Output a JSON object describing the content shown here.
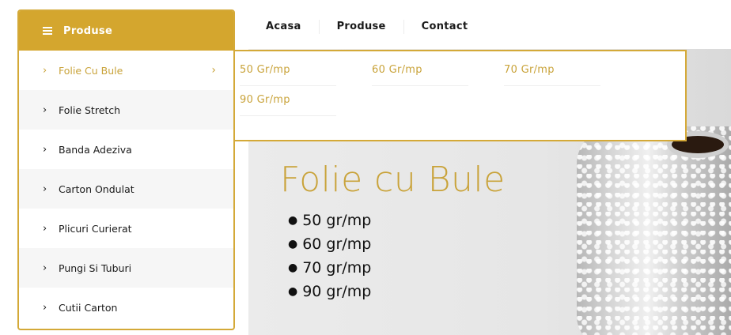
{
  "nav": {
    "items": [
      {
        "label": "Acasa"
      },
      {
        "label": "Produse"
      },
      {
        "label": "Contact"
      }
    ]
  },
  "categories": {
    "header": "Produse",
    "items": [
      {
        "label": "Folie Cu Bule",
        "active": true
      },
      {
        "label": "Folie Stretch"
      },
      {
        "label": "Banda Adeziva"
      },
      {
        "label": "Carton Ondulat"
      },
      {
        "label": "Plicuri Curierat"
      },
      {
        "label": "Pungi Si Tuburi"
      },
      {
        "label": "Cutii Carton"
      }
    ]
  },
  "submenu": {
    "items": [
      {
        "label": "50 Gr/mp"
      },
      {
        "label": "60 Gr/mp"
      },
      {
        "label": "70 Gr/mp"
      },
      {
        "label": "90 Gr/mp"
      }
    ]
  },
  "hero": {
    "title": "Folie cu Bule",
    "bullets": [
      "50 gr/mp",
      "60 gr/mp",
      "70 gr/mp",
      "90 gr/mp"
    ]
  },
  "colors": {
    "accent": "#d4a62e",
    "accent_text": "#c9a33a"
  },
  "icons": {
    "menu": "hamburger-icon",
    "chevron": "chevron-right-icon"
  }
}
